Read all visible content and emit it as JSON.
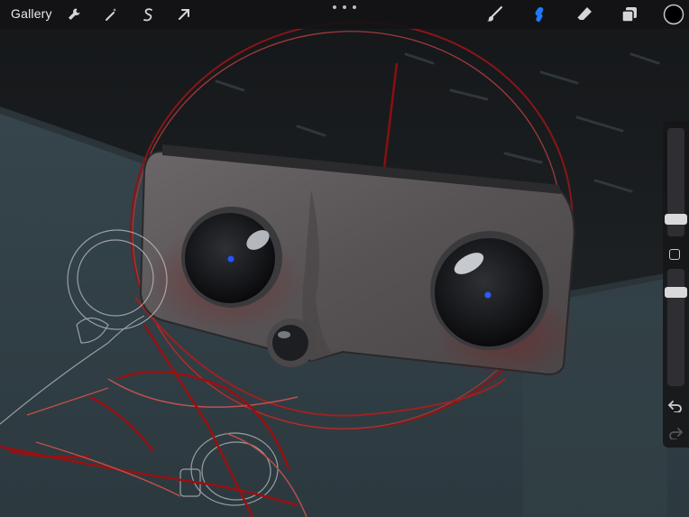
{
  "topbar": {
    "gallery_label": "Gallery",
    "left_tools": [
      "wrench-icon",
      "magic-wand-icon",
      "selection-icon",
      "transform-arrow-icon"
    ],
    "right_tools": [
      "brush-icon",
      "smudge-icon",
      "eraser-icon",
      "layers-icon",
      "color-swatch"
    ],
    "active_tool": "smudge-icon",
    "accent_color": "#1e7bff",
    "current_color": "#000000"
  },
  "sidebar": {
    "brush_size_level": 0.3,
    "opacity_level": 0.05
  }
}
